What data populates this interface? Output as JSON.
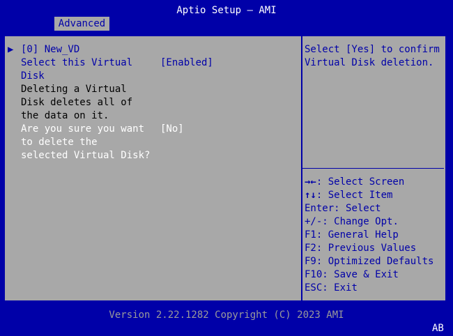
{
  "header": {
    "title": "Aptio Setup – AMI",
    "tab": "Advanced"
  },
  "menu": {
    "arrow": "▶",
    "vd_entry": "[0] New_VD",
    "select_vd": {
      "label_line1": "Select this Virtual",
      "label_line2": "Disk",
      "value": "[Enabled]"
    },
    "info_lines": [
      "Deleting a Virtual",
      "Disk deletes all of",
      "the data on it."
    ],
    "confirm": {
      "lines": [
        "Are you sure you want",
        "to delete the",
        "selected Virtual Disk?"
      ],
      "value": "[No]"
    }
  },
  "help": {
    "lines": [
      "Select [Yes] to confirm",
      "Virtual Disk deletion."
    ]
  },
  "keys": [
    {
      "key": "→←",
      "desc": ": Select Screen"
    },
    {
      "key": "↑↓",
      "desc": ": Select Item"
    },
    {
      "key": "Enter",
      "desc": ": Select"
    },
    {
      "key": "+/-",
      "desc": ": Change Opt."
    },
    {
      "key": "F1",
      "desc": ": General Help"
    },
    {
      "key": "F2",
      "desc": ": Previous Values"
    },
    {
      "key": "F9",
      "desc": ": Optimized Defaults"
    },
    {
      "key": "F10",
      "desc": ": Save & Exit"
    },
    {
      "key": "ESC",
      "desc": ": Exit"
    }
  ],
  "footer": {
    "version": "Version 2.22.1282 Copyright (C) 2023 AMI",
    "corner": "AB"
  },
  "colors": {
    "background": "#0000a8",
    "panel": "#a8a8a8",
    "text": "#000000",
    "highlight": "#ffffff"
  }
}
